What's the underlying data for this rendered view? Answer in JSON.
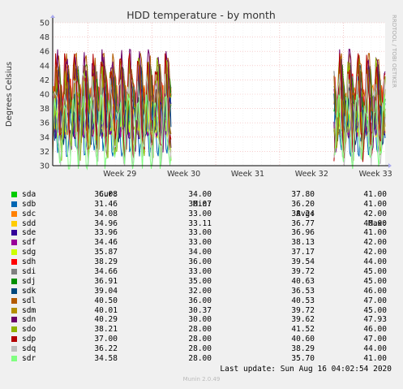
{
  "chart_data": {
    "type": "line",
    "title": "HDD temperature - by month",
    "ylabel": "Degrees Celsius",
    "watermark": "RRDTOOL / TOBI OETIKER",
    "ylim": [
      30,
      50
    ],
    "yticks": [
      30,
      32,
      34,
      36,
      38,
      40,
      42,
      44,
      46,
      48,
      50
    ],
    "xticks": [
      "Week 29",
      "Week 30",
      "Week 31",
      "Week 32",
      "Week 33"
    ],
    "x_range_weeks": [
      28.45,
      33.65
    ],
    "data_segments_weeks": [
      [
        28.45,
        30.3
      ],
      [
        32.85,
        33.65
      ]
    ],
    "series": [
      {
        "name": "sda",
        "color": "#00cc00",
        "cur": "36.08",
        "min": "34.00",
        "avg": "37.80",
        "max": "41.00"
      },
      {
        "name": "sdb",
        "color": "#0066b3",
        "cur": "31.46",
        "min": "30.07",
        "avg": "36.20",
        "max": "41.00"
      },
      {
        "name": "sdc",
        "color": "#ff8000",
        "cur": "34.08",
        "min": "33.00",
        "avg": "38.24",
        "max": "42.00"
      },
      {
        "name": "sdd",
        "color": "#ffcc00",
        "cur": "34.96",
        "min": "33.11",
        "avg": "36.77",
        "max": "40.00"
      },
      {
        "name": "sde",
        "color": "#330099",
        "cur": "33.96",
        "min": "33.00",
        "avg": "36.96",
        "max": "41.00"
      },
      {
        "name": "sdf",
        "color": "#990099",
        "cur": "34.46",
        "min": "33.00",
        "avg": "38.13",
        "max": "42.00"
      },
      {
        "name": "sdg",
        "color": "#ccff00",
        "cur": "35.87",
        "min": "34.00",
        "avg": "37.17",
        "max": "42.00"
      },
      {
        "name": "sdh",
        "color": "#ff0000",
        "cur": "38.29",
        "min": "36.00",
        "avg": "39.54",
        "max": "44.00"
      },
      {
        "name": "sdi",
        "color": "#808080",
        "cur": "34.66",
        "min": "33.00",
        "avg": "39.72",
        "max": "45.00"
      },
      {
        "name": "sdj",
        "color": "#008f00",
        "cur": "36.91",
        "min": "35.00",
        "avg": "40.63",
        "max": "45.00"
      },
      {
        "name": "sdk",
        "color": "#00487d",
        "cur": "39.04",
        "min": "32.00",
        "avg": "36.53",
        "max": "46.00"
      },
      {
        "name": "sdl",
        "color": "#b35a00",
        "cur": "40.50",
        "min": "36.00",
        "avg": "40.53",
        "max": "47.00"
      },
      {
        "name": "sdm",
        "color": "#b38f00",
        "cur": "40.01",
        "min": "30.37",
        "avg": "39.72",
        "max": "45.00"
      },
      {
        "name": "sdn",
        "color": "#6b006b",
        "cur": "40.29",
        "min": "30.00",
        "avg": "39.62",
        "max": "47.93"
      },
      {
        "name": "sdo",
        "color": "#8fb300",
        "cur": "38.21",
        "min": "28.00",
        "avg": "41.52",
        "max": "46.00"
      },
      {
        "name": "sdp",
        "color": "#b30000",
        "cur": "37.00",
        "min": "28.00",
        "avg": "40.60",
        "max": "47.00"
      },
      {
        "name": "sdq",
        "color": "#bebebe",
        "cur": "36.22",
        "min": "28.00",
        "avg": "38.29",
        "max": "44.00"
      },
      {
        "name": "sdr",
        "color": "#80ff80",
        "cur": "34.58",
        "min": "28.00",
        "avg": "35.70",
        "max": "41.00"
      }
    ]
  },
  "legend": {
    "h_cur": "Cur:",
    "h_min": "Min:",
    "h_avg": "Avg:",
    "h_max": "Max:"
  },
  "footer": {
    "last_update": "Last update: Sun Aug 16 04:02:54 2020",
    "munin": "Munin 2.0.49"
  }
}
